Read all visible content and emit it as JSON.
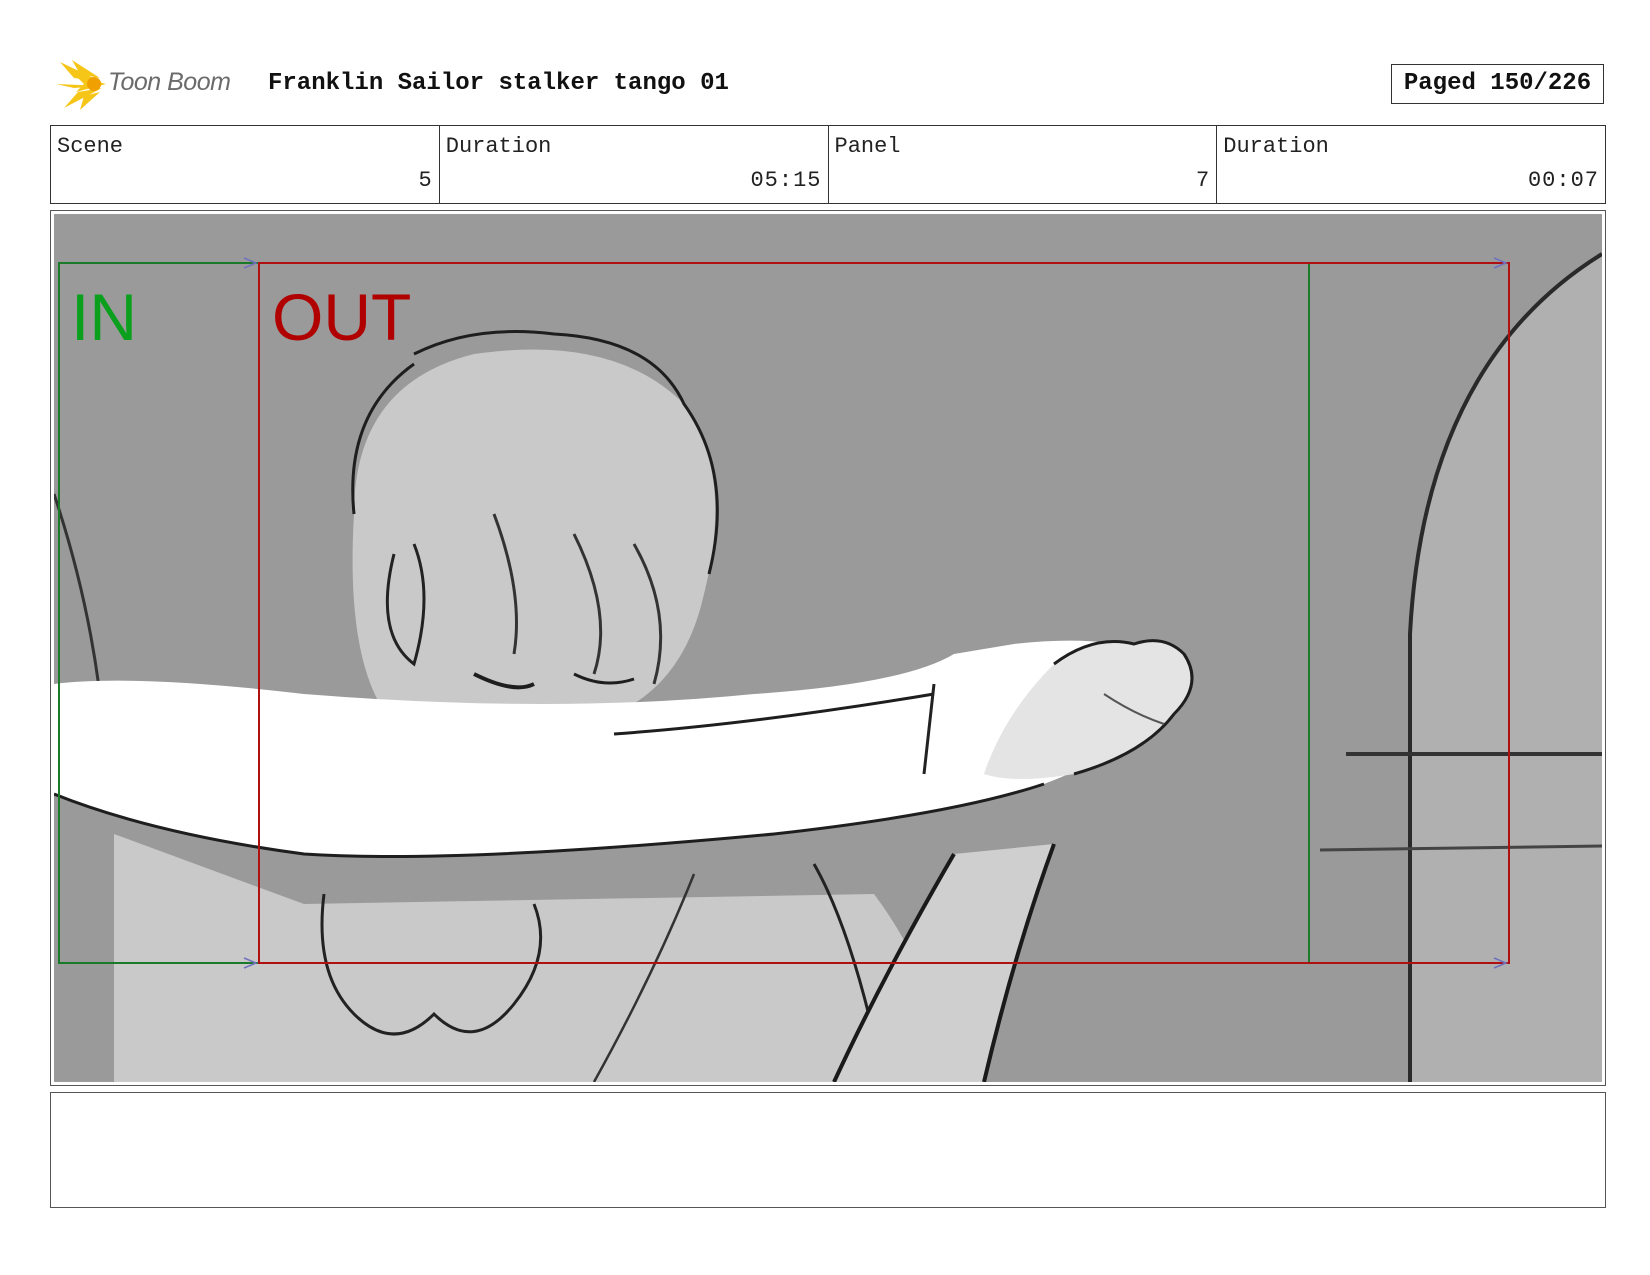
{
  "header": {
    "logo_text": "Toon Boom",
    "title": "Franklin Sailor stalker tango 01",
    "page_indicator": "Paged 150/226"
  },
  "info": [
    {
      "label": "Scene",
      "value": "5"
    },
    {
      "label": "Duration",
      "value": "05:15"
    },
    {
      "label": "Panel",
      "value": "7"
    },
    {
      "label": "Duration",
      "value": "00:07"
    }
  ],
  "panel": {
    "in_label": "IN",
    "out_label": "OUT",
    "colors": {
      "background": "#9a9a9a",
      "in_frame": "#1a7a2a",
      "in_text": "#0aa01e",
      "out_frame": "#b01010",
      "out_text": "#b00000",
      "figure_fill": "#c9c9c9",
      "sketch_line": "#1e1e1e"
    }
  },
  "notes": {
    "text": ""
  }
}
